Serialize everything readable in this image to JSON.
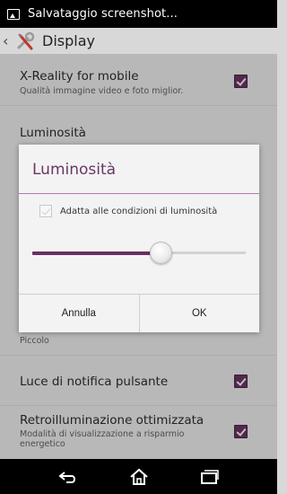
{
  "status_bar": {
    "notification_text": "Salvataggio screenshot...",
    "icon": "image-notification-icon"
  },
  "action_bar": {
    "title": "Display",
    "back_icon": "chevron-left-icon",
    "app_icon": "wrench-screwdriver-icon"
  },
  "settings": {
    "xreality": {
      "title": "X-Reality for mobile",
      "summary": "Qualità immagine video e foto miglior.",
      "checked": true
    },
    "brightness": {
      "title": "Luminosità"
    },
    "font_size": {
      "summary": "Piccolo"
    },
    "notification_light": {
      "title": "Luce di notifica pulsante",
      "checked": true
    },
    "backlight": {
      "title": "Retroilluminazione ottimizzata",
      "summary_line1": "Modalità di visualizzazione a risparmio",
      "summary_line2": "energetico",
      "checked": true
    }
  },
  "dialog": {
    "title": "Luminosità",
    "auto_label": "Adatta alle condizioni di luminosità",
    "auto_checked": true,
    "brightness_level": 0.6,
    "cancel_label": "Annulla",
    "ok_label": "OK"
  },
  "nav_bar": {
    "back_icon": "back-icon",
    "home_icon": "home-icon",
    "recents_icon": "recents-icon"
  },
  "colors": {
    "accent": "#6a3566",
    "checkbox": "#5b2a55"
  }
}
